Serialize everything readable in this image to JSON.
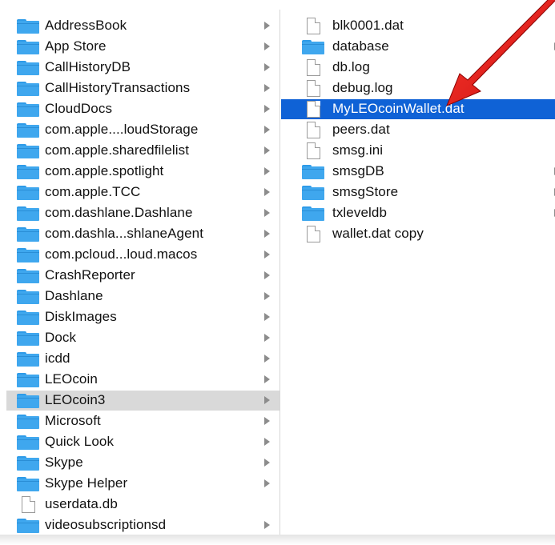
{
  "column1": {
    "items": [
      {
        "label": "AddressBook",
        "type": "folder",
        "arrow": true
      },
      {
        "label": "App Store",
        "type": "folder",
        "arrow": true
      },
      {
        "label": "CallHistoryDB",
        "type": "folder",
        "arrow": true
      },
      {
        "label": "CallHistoryTransactions",
        "type": "folder",
        "arrow": true
      },
      {
        "label": "CloudDocs",
        "type": "folder",
        "arrow": true
      },
      {
        "label": "com.apple....loudStorage",
        "type": "folder",
        "arrow": true
      },
      {
        "label": "com.apple.sharedfilelist",
        "type": "folder",
        "arrow": true
      },
      {
        "label": "com.apple.spotlight",
        "type": "folder",
        "arrow": true
      },
      {
        "label": "com.apple.TCC",
        "type": "folder",
        "arrow": true
      },
      {
        "label": "com.dashlane.Dashlane",
        "type": "folder",
        "arrow": true
      },
      {
        "label": "com.dashla...shlaneAgent",
        "type": "folder",
        "arrow": true
      },
      {
        "label": "com.pcloud...loud.macos",
        "type": "folder",
        "arrow": true
      },
      {
        "label": "CrashReporter",
        "type": "folder",
        "arrow": true
      },
      {
        "label": "Dashlane",
        "type": "folder",
        "arrow": true
      },
      {
        "label": "DiskImages",
        "type": "folder",
        "arrow": true
      },
      {
        "label": "Dock",
        "type": "folder",
        "arrow": true
      },
      {
        "label": "icdd",
        "type": "folder",
        "arrow": true
      },
      {
        "label": "LEOcoin",
        "type": "folder",
        "arrow": true
      },
      {
        "label": "LEOcoin3",
        "type": "folder",
        "arrow": true,
        "selected": "grey"
      },
      {
        "label": "Microsoft",
        "type": "folder",
        "arrow": true
      },
      {
        "label": "Quick Look",
        "type": "folder",
        "arrow": true
      },
      {
        "label": "Skype",
        "type": "folder",
        "arrow": true
      },
      {
        "label": "Skype Helper",
        "type": "folder",
        "arrow": true
      },
      {
        "label": "userdata.db",
        "type": "file",
        "arrow": false
      },
      {
        "label": "videosubscriptionsd",
        "type": "folder",
        "arrow": true
      }
    ]
  },
  "column2": {
    "items": [
      {
        "label": "blk0001.dat",
        "type": "file",
        "arrow": false
      },
      {
        "label": "database",
        "type": "folder",
        "arrow": true
      },
      {
        "label": "db.log",
        "type": "file",
        "arrow": false
      },
      {
        "label": "debug.log",
        "type": "file",
        "arrow": false
      },
      {
        "label": "MyLEOcoinWallet.dat",
        "type": "file",
        "arrow": false,
        "selected": "blue"
      },
      {
        "label": "peers.dat",
        "type": "file",
        "arrow": false
      },
      {
        "label": "smsg.ini",
        "type": "file",
        "arrow": false
      },
      {
        "label": "smsgDB",
        "type": "folder",
        "arrow": true
      },
      {
        "label": "smsgStore",
        "type": "folder",
        "arrow": true
      },
      {
        "label": "txleveldb",
        "type": "folder",
        "arrow": true
      },
      {
        "label": "wallet.dat copy",
        "type": "file",
        "arrow": false
      }
    ]
  },
  "colors": {
    "selection_blue": "#0f62d6",
    "selection_grey": "#d9d9d9",
    "folder": "#3fa7ee",
    "annotation_arrow": "#e02020"
  },
  "icons": {
    "folder": "folder-icon",
    "file": "document-icon",
    "disclosure": "chevron-right-icon",
    "annotation": "red-arrow-annotation"
  }
}
